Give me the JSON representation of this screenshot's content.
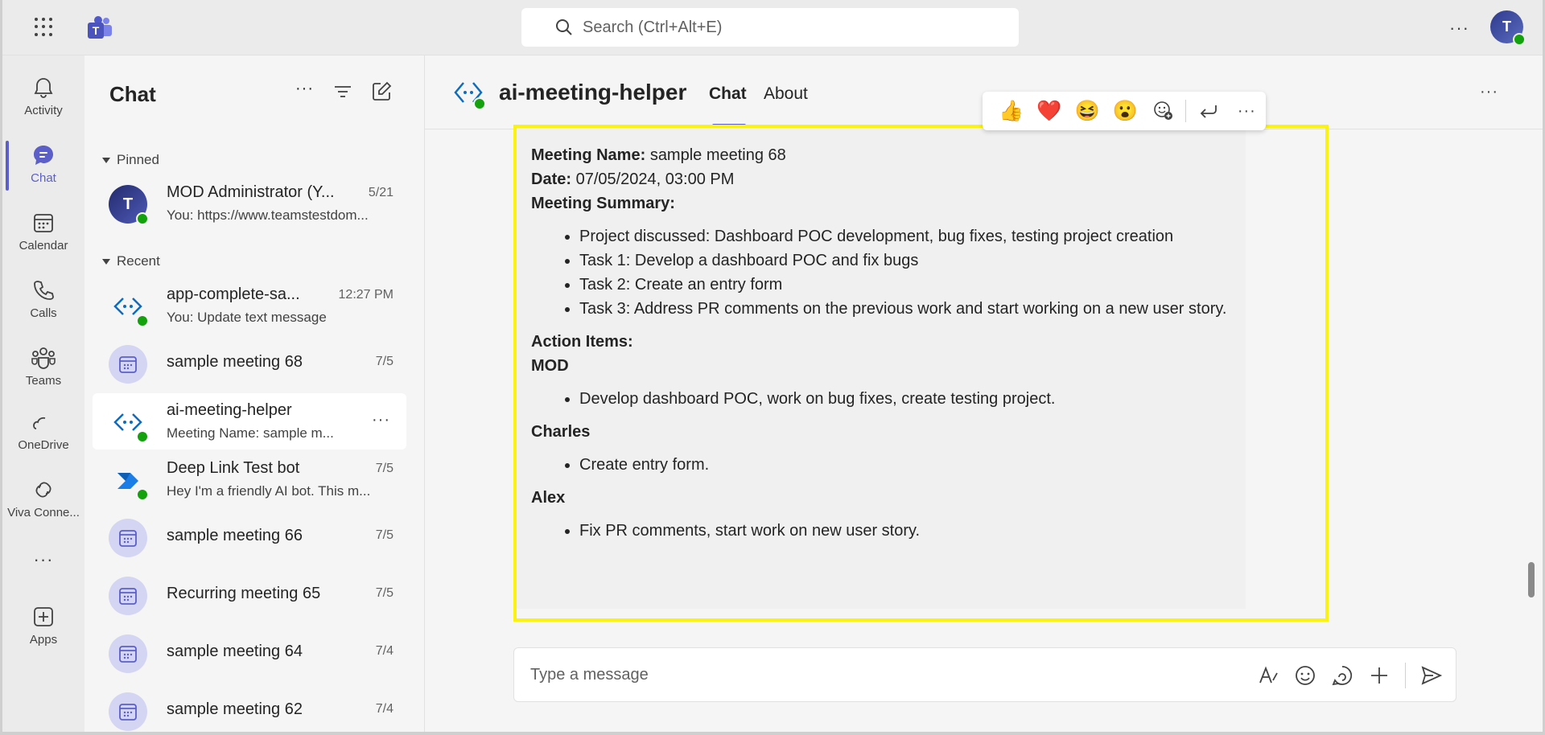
{
  "topbar": {
    "search_placeholder": "Search (Ctrl+Alt+E)",
    "more": "···",
    "avatar_initial": "T"
  },
  "rail": {
    "items": [
      {
        "label": "Activity"
      },
      {
        "label": "Chat"
      },
      {
        "label": "Calendar"
      },
      {
        "label": "Calls"
      },
      {
        "label": "Teams"
      },
      {
        "label": "OneDrive"
      },
      {
        "label": "Viva Conne..."
      },
      {
        "label": "···"
      },
      {
        "label": "Apps"
      }
    ]
  },
  "chatlist": {
    "title": "Chat",
    "pinned_label": "Pinned",
    "recent_label": "Recent",
    "pinned": [
      {
        "name": "MOD Administrator (Y...",
        "sub": "You: https://www.teamstestdom...",
        "time": "5/21",
        "initial": "T"
      }
    ],
    "recent": [
      {
        "name": "app-complete-sa...",
        "sub": "You: Update text message",
        "time": "12:27 PM"
      },
      {
        "name": "sample meeting 68",
        "sub": "",
        "time": "7/5"
      },
      {
        "name": "ai-meeting-helper",
        "sub": "Meeting Name: sample m...",
        "time": "",
        "more": "···"
      },
      {
        "name": "Deep Link Test bot",
        "sub": "Hey I'm a friendly AI bot. This m...",
        "time": "7/5"
      },
      {
        "name": "sample meeting 66",
        "sub": "",
        "time": "7/5"
      },
      {
        "name": "Recurring meeting 65",
        "sub": "",
        "time": "7/5"
      },
      {
        "name": "sample meeting 64",
        "sub": "",
        "time": "7/4"
      },
      {
        "name": "sample meeting 62",
        "sub": "",
        "time": "7/4"
      }
    ]
  },
  "main": {
    "title": "ai-meeting-helper",
    "tabs": [
      "Chat",
      "About"
    ],
    "more": "···",
    "message": {
      "meeting_name_label": "Meeting Name:",
      "meeting_name": "sample meeting 68",
      "date_label": "Date:",
      "date": "07/05/2024, 03:00 PM",
      "summary_label": "Meeting Summary:",
      "summary": [
        "Project discussed: Dashboard POC development, bug fixes, testing project creation",
        "Task 1: Develop a dashboard POC and fix bugs",
        "Task 2: Create an entry form",
        "Task 3: Address PR comments on the previous work and start working on a new user story."
      ],
      "action_items_label": "Action Items:",
      "people": [
        {
          "name": "MOD",
          "items": [
            "Develop dashboard POC, work on bug fixes, create testing project."
          ]
        },
        {
          "name": "Charles",
          "items": [
            "Create entry form."
          ]
        },
        {
          "name": "Alex",
          "items": [
            "Fix PR comments, start work on new user story."
          ]
        }
      ]
    },
    "reactions": [
      "👍",
      "❤️",
      "😆",
      "😮"
    ],
    "composer_placeholder": "Type a message"
  }
}
